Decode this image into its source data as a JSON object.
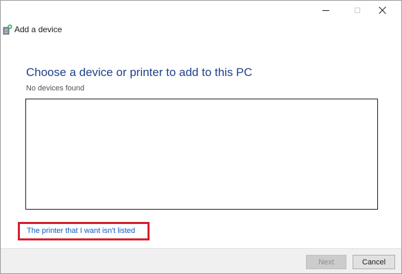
{
  "window": {
    "title": "Add a device"
  },
  "icons": {
    "device": "device-add-icon",
    "minimize": "minimize-icon",
    "maximize": "maximize-icon",
    "close": "close-icon"
  },
  "main": {
    "heading": "Choose a device or printer to add to this PC",
    "status": "No devices found",
    "devices": [],
    "printer_link": "The printer that I want isn't listed"
  },
  "footer": {
    "next_label": "Next",
    "cancel_label": "Cancel",
    "next_enabled": false
  },
  "colors": {
    "heading": "#1e3f8a",
    "link": "#0b5bc7",
    "highlight_border": "#d71f2c",
    "footer_bg": "#f0f0f0"
  }
}
